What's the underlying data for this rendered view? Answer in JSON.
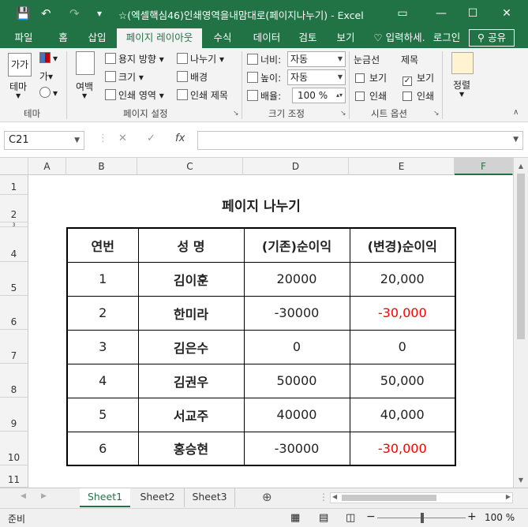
{
  "titlebar": {
    "title": "☆(엑셀핵심46)인쇄영역을내맘대로(페이지나누기) - Excel",
    "save_icon": "💾",
    "undo_icon": "↶",
    "redo_icon": "↷",
    "customize_icon": "▾"
  },
  "tabs": [
    "파일",
    "홈",
    "삽입",
    "페이지 레이아웃",
    "수식",
    "데이터",
    "검토",
    "보기"
  ],
  "tell_me": "입력하세.",
  "signin": "로그인",
  "share": "공유",
  "ribbon": {
    "theme": {
      "label": "테마",
      "group": "테마"
    },
    "margins": "여백",
    "orientation": "용지 방향",
    "size": "크기",
    "print_area": "인쇄 영역",
    "breaks": "나누기",
    "background": "배경",
    "print_titles": "인쇄 제목",
    "page_setup_group": "페이지 설정",
    "width_label": "너비:",
    "width_value": "자동",
    "height_label": "높이:",
    "height_value": "자동",
    "scale_label": "배율:",
    "scale_value": "100 %",
    "scale_group": "크기 조정",
    "gridlines": "눈금선",
    "headings": "제목",
    "view": "보기",
    "print": "인쇄",
    "sheet_options_group": "시트 옵션",
    "arrange": "정렬"
  },
  "formula_bar": {
    "name_box": "C21",
    "cancel": "✕",
    "enter": "✓",
    "fx": "fx",
    "content": ""
  },
  "columns": [
    "A",
    "B",
    "C",
    "D",
    "E",
    "F"
  ],
  "rows": [
    "1",
    "2",
    "3",
    "4",
    "5",
    "6",
    "7",
    "8",
    "9",
    "10",
    "11"
  ],
  "sheet": {
    "title": "페이지  나누기",
    "headers": [
      "연번",
      "성    명",
      "(기존)순이익",
      "(변경)순이익"
    ],
    "records": [
      {
        "no": "1",
        "name": "김이훈",
        "old": "20000",
        "new": "20,000",
        "negative": false
      },
      {
        "no": "2",
        "name": "한미라",
        "old": "-30000",
        "new": "-30,000",
        "negative": true
      },
      {
        "no": "3",
        "name": "김은수",
        "old": "0",
        "new": "0",
        "negative": false
      },
      {
        "no": "4",
        "name": "김권우",
        "old": "50000",
        "new": "50,000",
        "negative": false
      },
      {
        "no": "5",
        "name": "서교주",
        "old": "40000",
        "new": "40,000",
        "negative": false
      },
      {
        "no": "6",
        "name": "홍승현",
        "old": "-30000",
        "new": "-30,000",
        "negative": true
      }
    ]
  },
  "sheet_tabs": [
    "Sheet1",
    "Sheet2",
    "Sheet3"
  ],
  "status": {
    "ready": "준비",
    "zoom": "100 %"
  },
  "colors": {
    "excel_green": "#217346",
    "negative_red": "#ff0000"
  }
}
